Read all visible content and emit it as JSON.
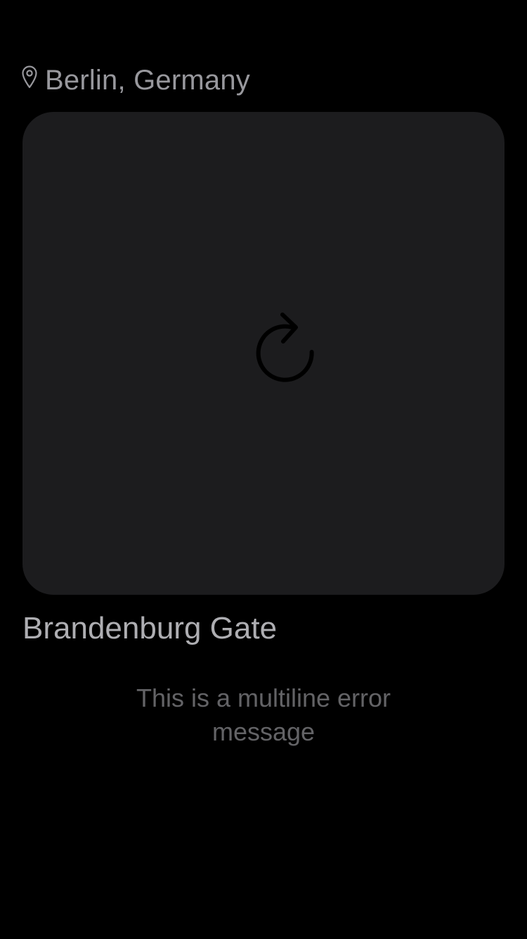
{
  "location": {
    "icon": "map-pin-icon",
    "label": "Berlin, Germany"
  },
  "card": {
    "reload_icon": "reload-icon"
  },
  "place": {
    "title": "Brandenburg Gate"
  },
  "error": {
    "message": "This is a multiline error message"
  },
  "colors": {
    "background": "#000000",
    "card": "#1c1c1e",
    "location_text": "#98989d",
    "title_text": "#aeaeb2",
    "error_text": "#636366",
    "icon_stroke": "#000000"
  }
}
